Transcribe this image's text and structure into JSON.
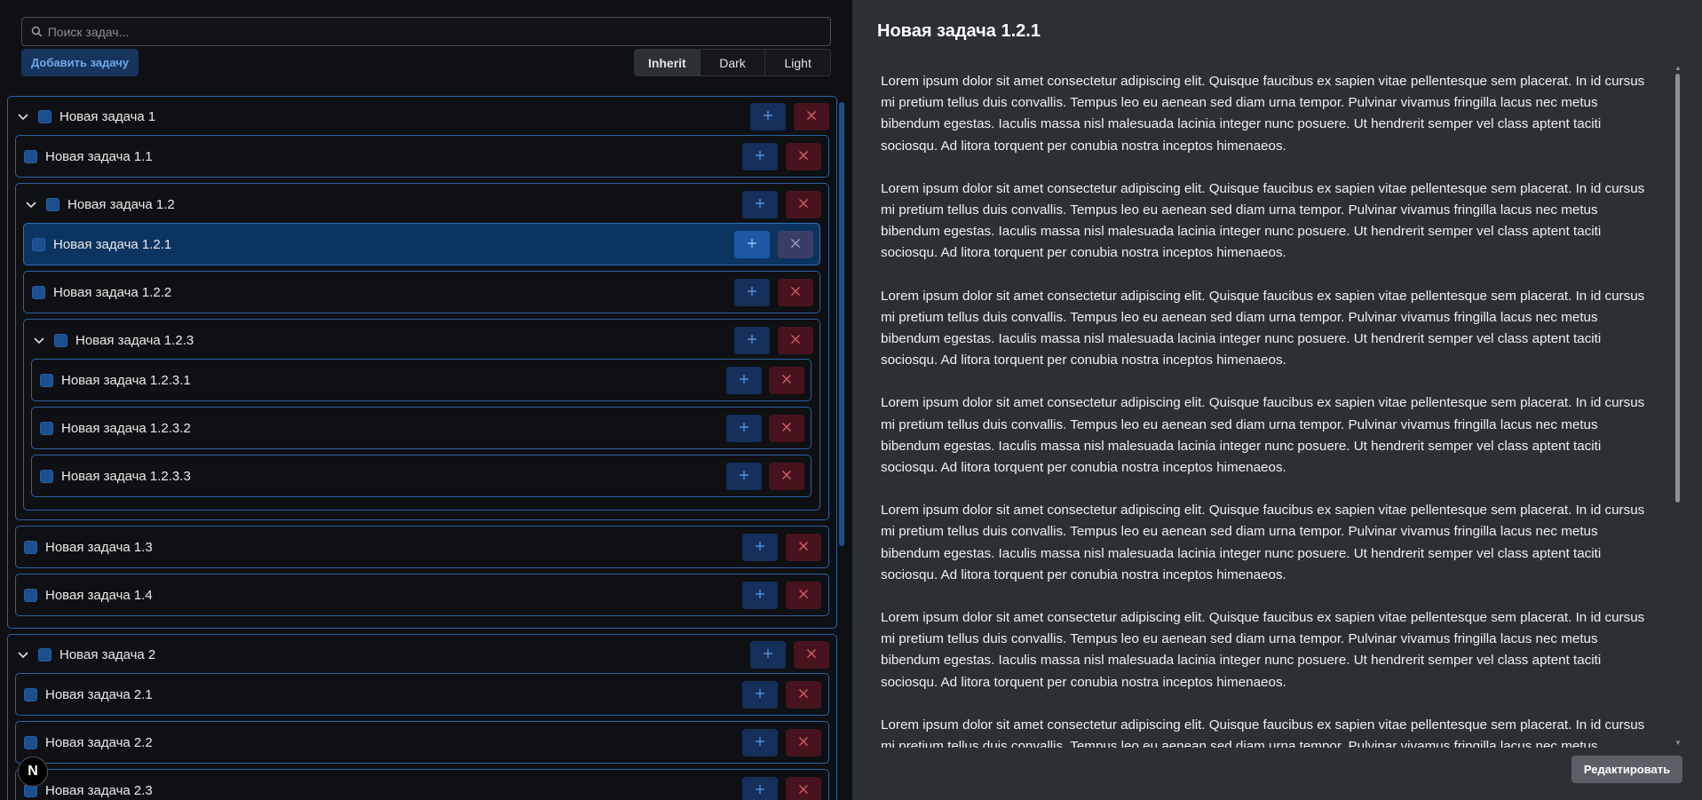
{
  "search": {
    "placeholder": "Поиск задач..."
  },
  "toolbar": {
    "add_label": "Добавить задачу"
  },
  "theme": {
    "options": [
      "Inherit",
      "Dark",
      "Light"
    ],
    "selected": "Inherit"
  },
  "tasks": {
    "t1": "Новая задача 1",
    "t1_1": "Новая задача 1.1",
    "t1_2": "Новая задача 1.2",
    "t1_2_1": "Новая задача 1.2.1",
    "t1_2_2": "Новая задача 1.2.2",
    "t1_2_3": "Новая задача 1.2.3",
    "t1_2_3_1": "Новая задача 1.2.3.1",
    "t1_2_3_2": "Новая задача 1.2.3.2",
    "t1_2_3_3": "Новая задача 1.2.3.3",
    "t1_3": "Новая задача 1.3",
    "t1_4": "Новая задача 1.4",
    "t2": "Новая задача 2",
    "t2_1": "Новая задача 2.1",
    "t2_2": "Новая задача 2.2",
    "t2_3": "Новая задача 2.3"
  },
  "selected_task": "Новая задача 1.2.1",
  "detail": {
    "title": "Новая задача 1.2.1",
    "paragraphs": [
      "Lorem ipsum dolor sit amet consectetur adipiscing elit. Quisque faucibus ex sapien vitae pellentesque sem placerat. In id cursus mi pretium tellus duis convallis. Tempus leo eu aenean sed diam urna tempor. Pulvinar vivamus fringilla lacus nec metus bibendum egestas. Iaculis massa nisl malesuada lacinia integer nunc posuere. Ut hendrerit semper vel class aptent taciti sociosqu. Ad litora torquent per conubia nostra inceptos himenaeos.",
      "Lorem ipsum dolor sit amet consectetur adipiscing elit. Quisque faucibus ex sapien vitae pellentesque sem placerat. In id cursus mi pretium tellus duis convallis. Tempus leo eu aenean sed diam urna tempor. Pulvinar vivamus fringilla lacus nec metus bibendum egestas. Iaculis massa nisl malesuada lacinia integer nunc posuere. Ut hendrerit semper vel class aptent taciti sociosqu. Ad litora torquent per conubia nostra inceptos himenaeos.",
      "Lorem ipsum dolor sit amet consectetur adipiscing elit. Quisque faucibus ex sapien vitae pellentesque sem placerat. In id cursus mi pretium tellus duis convallis. Tempus leo eu aenean sed diam urna tempor. Pulvinar vivamus fringilla lacus nec metus bibendum egestas. Iaculis massa nisl malesuada lacinia integer nunc posuere. Ut hendrerit semper vel class aptent taciti sociosqu. Ad litora torquent per conubia nostra inceptos himenaeos.",
      "Lorem ipsum dolor sit amet consectetur adipiscing elit. Quisque faucibus ex sapien vitae pellentesque sem placerat. In id cursus mi pretium tellus duis convallis. Tempus leo eu aenean sed diam urna tempor. Pulvinar vivamus fringilla lacus nec metus bibendum egestas. Iaculis massa nisl malesuada lacinia integer nunc posuere. Ut hendrerit semper vel class aptent taciti sociosqu. Ad litora torquent per conubia nostra inceptos himenaeos.",
      "Lorem ipsum dolor sit amet consectetur adipiscing elit. Quisque faucibus ex sapien vitae pellentesque sem placerat. In id cursus mi pretium tellus duis convallis. Tempus leo eu aenean sed diam urna tempor. Pulvinar vivamus fringilla lacus nec metus bibendum egestas. Iaculis massa nisl malesuada lacinia integer nunc posuere. Ut hendrerit semper vel class aptent taciti sociosqu. Ad litora torquent per conubia nostra inceptos himenaeos.",
      "Lorem ipsum dolor sit amet consectetur adipiscing elit. Quisque faucibus ex sapien vitae pellentesque sem placerat. In id cursus mi pretium tellus duis convallis. Tempus leo eu aenean sed diam urna tempor. Pulvinar vivamus fringilla lacus nec metus bibendum egestas. Iaculis massa nisl malesuada lacinia integer nunc posuere. Ut hendrerit semper vel class aptent taciti sociosqu. Ad litora torquent per conubia nostra inceptos himenaeos.",
      "Lorem ipsum dolor sit amet consectetur adipiscing elit. Quisque faucibus ex sapien vitae pellentesque sem placerat. In id cursus mi pretium tellus duis convallis. Tempus leo eu aenean sed diam urna tempor. Pulvinar vivamus fringilla lacus nec metus bibendum egestas. Iaculis massa nisl malesuada lacinia integer nunc posuere. Ut hendrerit semper vel class aptent taciti sociosqu. Ad litora torquent per conubia nostra inceptos himenaeos."
    ],
    "edit_label": "Редактировать"
  },
  "badge": "N",
  "colors": {
    "accent": "#2a63a4",
    "checkbox": "#1b4f8e",
    "add_button_bg": "#15305a",
    "delete_button_bg": "#47141d",
    "selected_row_bg": "#0c3461",
    "panel_bg": "#2c2f33"
  },
  "icons": {
    "search": "search-icon",
    "chevron": "chevron-down-icon",
    "add": "plus-icon",
    "delete": "close-icon"
  }
}
